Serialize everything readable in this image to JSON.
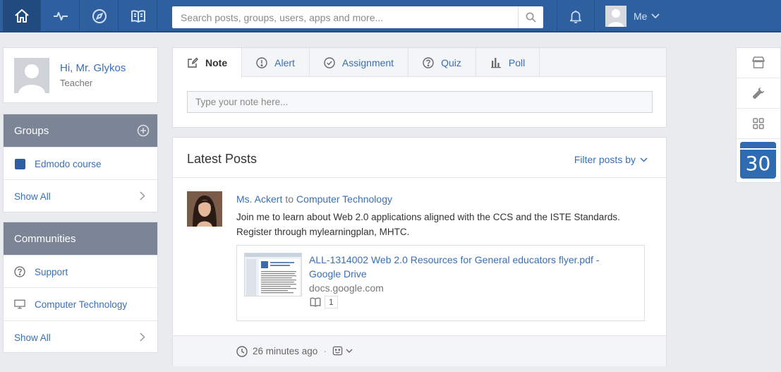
{
  "topbar": {
    "nav": [
      {
        "name": "home-icon"
      },
      {
        "name": "activity-icon"
      },
      {
        "name": "discover-icon"
      },
      {
        "name": "library-icon"
      }
    ],
    "search_placeholder": "Search posts, groups, users, apps and more...",
    "me_label": "Me"
  },
  "profile": {
    "greeting": "Hi, Mr. Glykos",
    "role": "Teacher"
  },
  "groups": {
    "title": "Groups",
    "items": [
      {
        "label": "Edmodo course",
        "color": "#2e5f9e"
      }
    ],
    "show_all": "Show All"
  },
  "communities": {
    "title": "Communities",
    "items": [
      {
        "label": "Support",
        "icon": "help-circle-icon"
      },
      {
        "label": "Computer Technology",
        "icon": "monitor-icon"
      }
    ],
    "show_all": "Show All"
  },
  "composer": {
    "tabs": [
      {
        "label": "Note",
        "icon": "note-icon",
        "active": true
      },
      {
        "label": "Alert",
        "icon": "alert-icon"
      },
      {
        "label": "Assignment",
        "icon": "assignment-icon"
      },
      {
        "label": "Quiz",
        "icon": "quiz-icon"
      },
      {
        "label": "Poll",
        "icon": "poll-icon"
      }
    ],
    "note_placeholder": "Type your note here..."
  },
  "posts": {
    "title": "Latest Posts",
    "filter_label": "Filter posts by",
    "items": [
      {
        "author": "Ms. Ackert",
        "to": "to",
        "group": "Computer Technology",
        "body": "Join me to learn about Web 2.0 applications aligned with the CCS and the ISTE Standards. Register through mylearningplan, MHTC.",
        "attachment": {
          "title": "ALL-1314002 Web 2.0 Resources for General educators flyer.pdf - Google Drive",
          "domain": "docs.google.com",
          "library_count": "1"
        },
        "time": "26 minutes ago"
      }
    ]
  },
  "rail": {
    "calendar_day": "30"
  },
  "colors": {
    "topbar": "#2e5f9e",
    "link": "#3a6fb5",
    "panel_header": "#7c8595"
  }
}
